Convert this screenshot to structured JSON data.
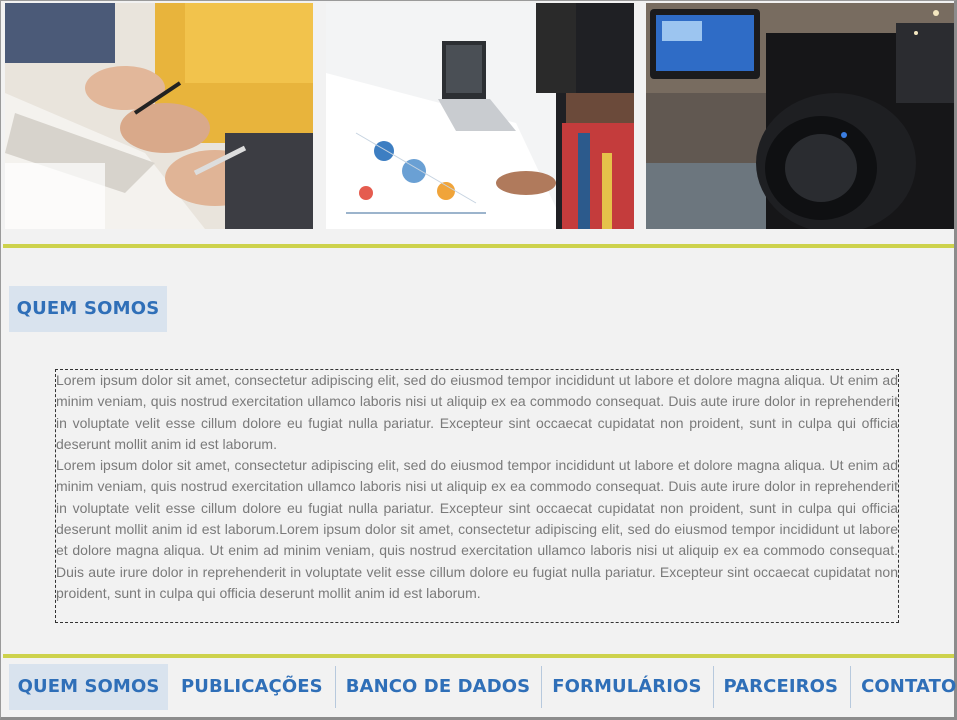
{
  "hero_images": [
    {
      "description": "people-taking-notes-photo"
    },
    {
      "description": "charts-and-laptop-photo"
    },
    {
      "description": "video-camera-photo"
    }
  ],
  "section": {
    "title": "QUEM SOMOS"
  },
  "content": {
    "paragraph_1": "Lorem ipsum dolor sit amet, consectetur adipiscing elit, sed do eiusmod tempor incididunt ut labore et dolore magna aliqua. Ut enim ad minim veniam, quis nostrud exercitation ullamco laboris nisi ut aliquip ex ea commodo consequat. Duis aute irure dolor in reprehenderit in voluptate velit esse cillum dolore eu fugiat nulla pariatur. Excepteur sint occaecat cupidatat non proident, sunt in culpa qui officia deserunt mollit anim id est laborum.",
    "paragraph_2": "Lorem ipsum dolor sit amet, consectetur adipiscing elit, sed do eiusmod tempor incididunt ut labore et dolore magna aliqua. Ut enim ad minim veniam, quis nostrud exercitation ullamco laboris nisi ut aliquip ex ea commodo consequat. Duis aute irure dolor in reprehenderit in voluptate velit esse cillum dolore eu fugiat nulla pariatur. Excepteur sint occaecat cupidatat non proident, sunt in culpa qui officia deserunt mollit anim id est laborum.Lorem ipsum dolor sit amet, consectetur adipiscing elit, sed do eiusmod tempor incididunt ut labore et dolore magna aliqua. Ut enim ad minim veniam, quis nostrud exercitation ullamco laboris nisi ut aliquip ex ea commodo consequat. Duis aute irure dolor in reprehenderit in voluptate velit esse cillum dolore eu fugiat nulla pariatur. Excepteur sint occaecat cupidatat non proident, sunt in culpa qui officia deserunt mollit anim id est laborum."
  },
  "nav": {
    "items": [
      {
        "label": "QUEM SOMOS",
        "active": true
      },
      {
        "label": "PUBLICAÇÕES",
        "active": false
      },
      {
        "label": "BANCO DE DADOS",
        "active": false
      },
      {
        "label": "FORMULÁRIOS",
        "active": false
      },
      {
        "label": "PARCEIROS",
        "active": false
      },
      {
        "label": "CONTATOS",
        "active": false
      }
    ]
  },
  "colors": {
    "accent_rule": "#cdd24c",
    "nav_text": "#2f6fb8",
    "active_bg": "#d9e3ee",
    "body_text": "#7a7a7a"
  }
}
